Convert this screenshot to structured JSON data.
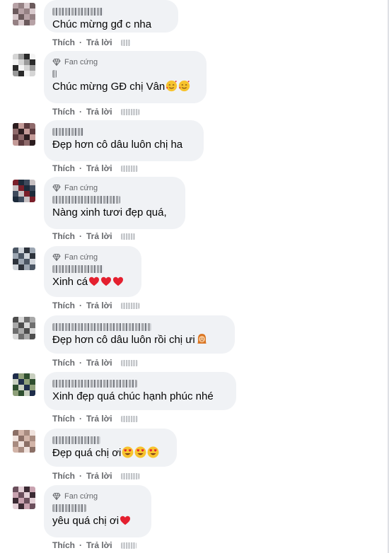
{
  "comments": [
    {
      "badge": "",
      "text": "Chúc mừng gđ c nha",
      "emojis": [],
      "actions": {
        "like": "Thích",
        "reply": "Trả lời"
      },
      "palette": [
        "#b7a2a6",
        "#6b5a5c",
        "#d8c9cc",
        "#958184"
      ]
    },
    {
      "badge": "Fan cứng",
      "text": "Chúc mừng GĐ chị Vân",
      "emojis": [
        "smiling-hearts-emoji",
        "smiling-hearts-emoji"
      ],
      "actions": {
        "like": "Thích",
        "reply": "Trả lời"
      },
      "palette": [
        "#f4f4f4",
        "#2a2a2a",
        "#9a9a9a",
        "#d5d5d5"
      ]
    },
    {
      "badge": "",
      "text": "Đẹp hơn cô dâu luôn chị ha",
      "emojis": [],
      "actions": {
        "like": "Thích",
        "reply": "Trả lời"
      },
      "palette": [
        "#5c3a3d",
        "#c49b98",
        "#2b1c1e",
        "#8f6a6b"
      ]
    },
    {
      "badge": "Fan cứng",
      "text": "Nàng xinh tươi đẹp quá,",
      "emojis": [],
      "actions": {
        "like": "Thích",
        "reply": "Trả lời"
      },
      "palette": [
        "#1c2a3a",
        "#7a1f2a",
        "#c7c0c2",
        "#3e4a5c"
      ]
    },
    {
      "badge": "Fan cứng",
      "text": "Xinh cá",
      "emojis": [
        "red-heart-emoji",
        "red-heart-emoji",
        "red-heart-emoji"
      ],
      "actions": {
        "like": "Thích",
        "reply": "Trả lời"
      },
      "palette": [
        "#4b5664",
        "#9ca6b2",
        "#2d333c",
        "#cfd4da"
      ]
    },
    {
      "badge": "",
      "text": "Đẹp hơn cô dâu luôn rồi chị ưi",
      "emojis": [
        "woman-emoji"
      ],
      "actions": {
        "like": "Thích",
        "reply": "Trả lời"
      },
      "palette": [
        "#a9a9a9",
        "#6e6e6e",
        "#d9d9d9",
        "#4d4d4d"
      ]
    },
    {
      "badge": "",
      "text": "Xinh đẹp quá chúc hạnh phúc nhé",
      "emojis": [],
      "actions": {
        "like": "Thích",
        "reply": "Trả lời"
      },
      "palette": [
        "#2f4f2f",
        "#8fa07a",
        "#1e2d4a",
        "#c8cfbf"
      ]
    },
    {
      "badge": "",
      "text": "Đẹp quá chị ơi",
      "emojis": [
        "heart-eyes-emoji",
        "heart-eyes-emoji",
        "heart-eyes-emoji"
      ],
      "actions": {
        "like": "Thích",
        "reply": "Trả lời"
      },
      "palette": [
        "#d2b4a8",
        "#8b6f66",
        "#efe1dc",
        "#a88b80"
      ]
    },
    {
      "badge": "Fan cứng",
      "text": "yêu quá chị ơi",
      "emojis": [
        "red-heart-emoji"
      ],
      "actions": {
        "like": "Thích",
        "reply": "Trả lời"
      },
      "palette": [
        "#6b4f5c",
        "#c9a3b0",
        "#3b2a33",
        "#e3cfd6"
      ]
    }
  ]
}
